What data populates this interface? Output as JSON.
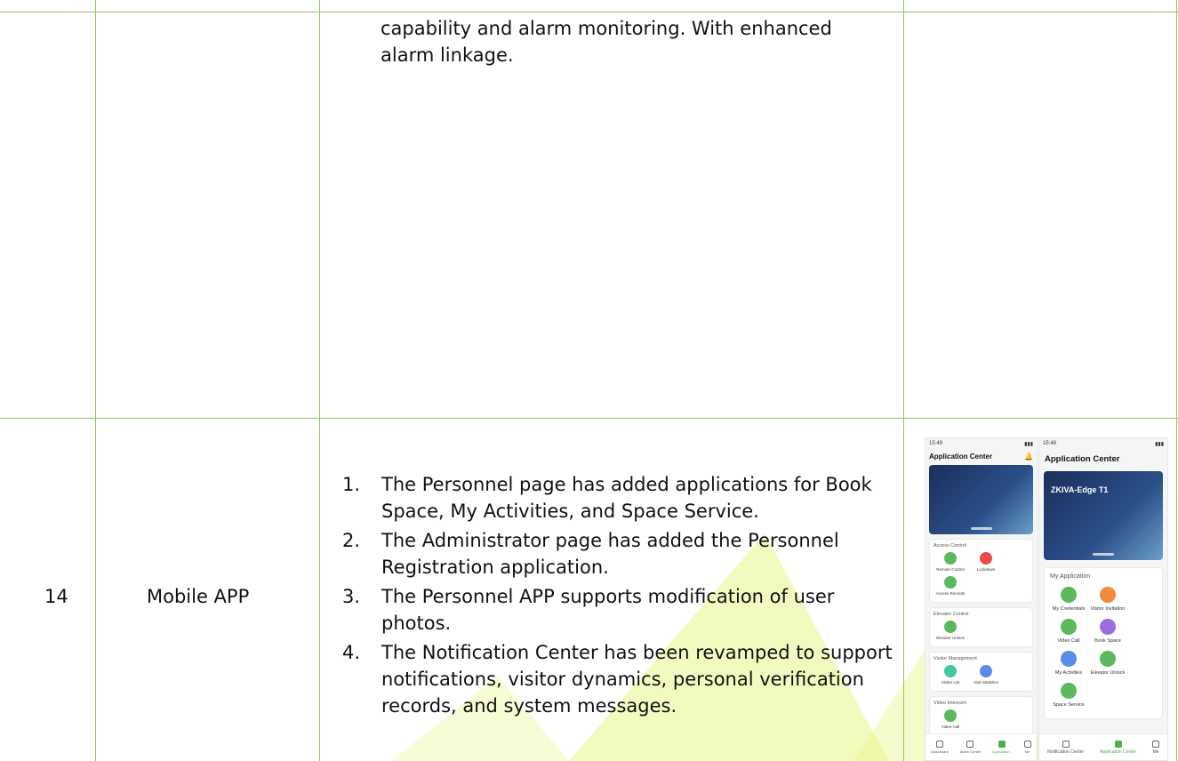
{
  "top_row": {
    "description": "capability and alarm monitoring. With enhanced alarm linkage."
  },
  "row_14": {
    "number": "14",
    "module": "Mobile APP",
    "items": [
      {
        "num": "1.",
        "text": "The Personnel page has added applications for Book Space, My Activities, and Space Service."
      },
      {
        "num": "2.",
        "text": "The Administrator page  has added the Personnel Registration application."
      },
      {
        "num": "3.",
        "text": "The Personnel APP supports modification of user photos."
      },
      {
        "num": "4.",
        "text": "The Notification Center has been revamped to support notifications, visitor dynamics, personal verification records, and system messages."
      }
    ]
  },
  "phone_a": {
    "time": "15:49",
    "title": "Application Center",
    "sections": [
      {
        "header": "Access Control",
        "apps": [
          "Remote Control",
          "Lockdown",
          "Access Records"
        ]
      },
      {
        "header": "Elevator Control",
        "apps": [
          "Elevator Unlock"
        ]
      },
      {
        "header": "Visitor Management",
        "apps": [
          "Visitor List",
          "Visit Statistics"
        ]
      },
      {
        "header": "Video Intercom",
        "apps": [
          "Video Call"
        ]
      }
    ],
    "tabs": [
      "Dashboard",
      "Alarm Center",
      "Application...",
      "Me"
    ]
  },
  "phone_b": {
    "time": "15:48",
    "title": "Application Center",
    "banner_brand": "ZKIVA-Edge T1",
    "section_header": "My Application",
    "apps": [
      "My Credentials",
      "Visitor Invitation",
      "Video Call",
      "Book Space",
      "My Activities",
      "Elevator Unlock",
      "Space Service"
    ],
    "tabs": [
      "Notification Center",
      "Application Center",
      "Me"
    ]
  },
  "colors": {
    "grid": "#8fc655",
    "watermark": "#d8f044",
    "app_green": "#5cb85c",
    "app_red": "#e84c4c",
    "app_orange": "#f08a3c",
    "app_purple": "#9a6ee0",
    "app_blue": "#5b8de8"
  }
}
